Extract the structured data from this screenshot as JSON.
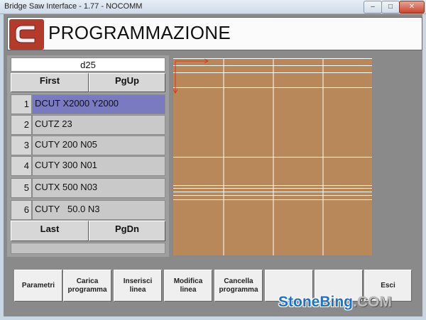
{
  "window": {
    "title": "Bridge Saw Interface - 1.77 - NOCOMM",
    "minimize_glyph": "–",
    "maximize_glyph": "□",
    "close_glyph": "✕"
  },
  "header": {
    "logo_icon": "c-logo-icon",
    "title": "PROGRAMMAZIONE"
  },
  "program": {
    "file_name": "d25",
    "nav_top": {
      "first": "First",
      "pgup": "PgUp"
    },
    "nav_bottom": {
      "last": "Last",
      "pgdn": "PgDn"
    },
    "selected_row": 1,
    "rows": [
      {
        "num": "1",
        "text": "DCUT X2000 Y2000"
      },
      {
        "num": "2",
        "text": "CUTZ 23"
      },
      {
        "num": "3",
        "text": "CUTY 200 N05"
      },
      {
        "num": "4",
        "text": "CUTY 300 N01"
      },
      {
        "num": "5",
        "text": "CUTX 500 N03"
      },
      {
        "num": "6",
        "text": "CUTY   50.0 N3"
      }
    ]
  },
  "preview": {
    "slab_color": "#b8885a",
    "line_color": "#ffffff",
    "origin_color": "#e0301e"
  },
  "function_buttons": [
    {
      "label1": "Parametri",
      "label2": ""
    },
    {
      "label1": "Carica",
      "label2": "programma"
    },
    {
      "label1": "Inserisci",
      "label2": "linea"
    },
    {
      "label1": "Modifica",
      "label2": "linea"
    },
    {
      "label1": "Cancella",
      "label2": "programma"
    },
    {
      "label1": "",
      "label2": ""
    },
    {
      "label1": "",
      "label2": ""
    },
    {
      "label1": "Esci",
      "label2": ""
    }
  ],
  "watermark": {
    "part1": "StoneBing",
    "part2": ".COM"
  }
}
